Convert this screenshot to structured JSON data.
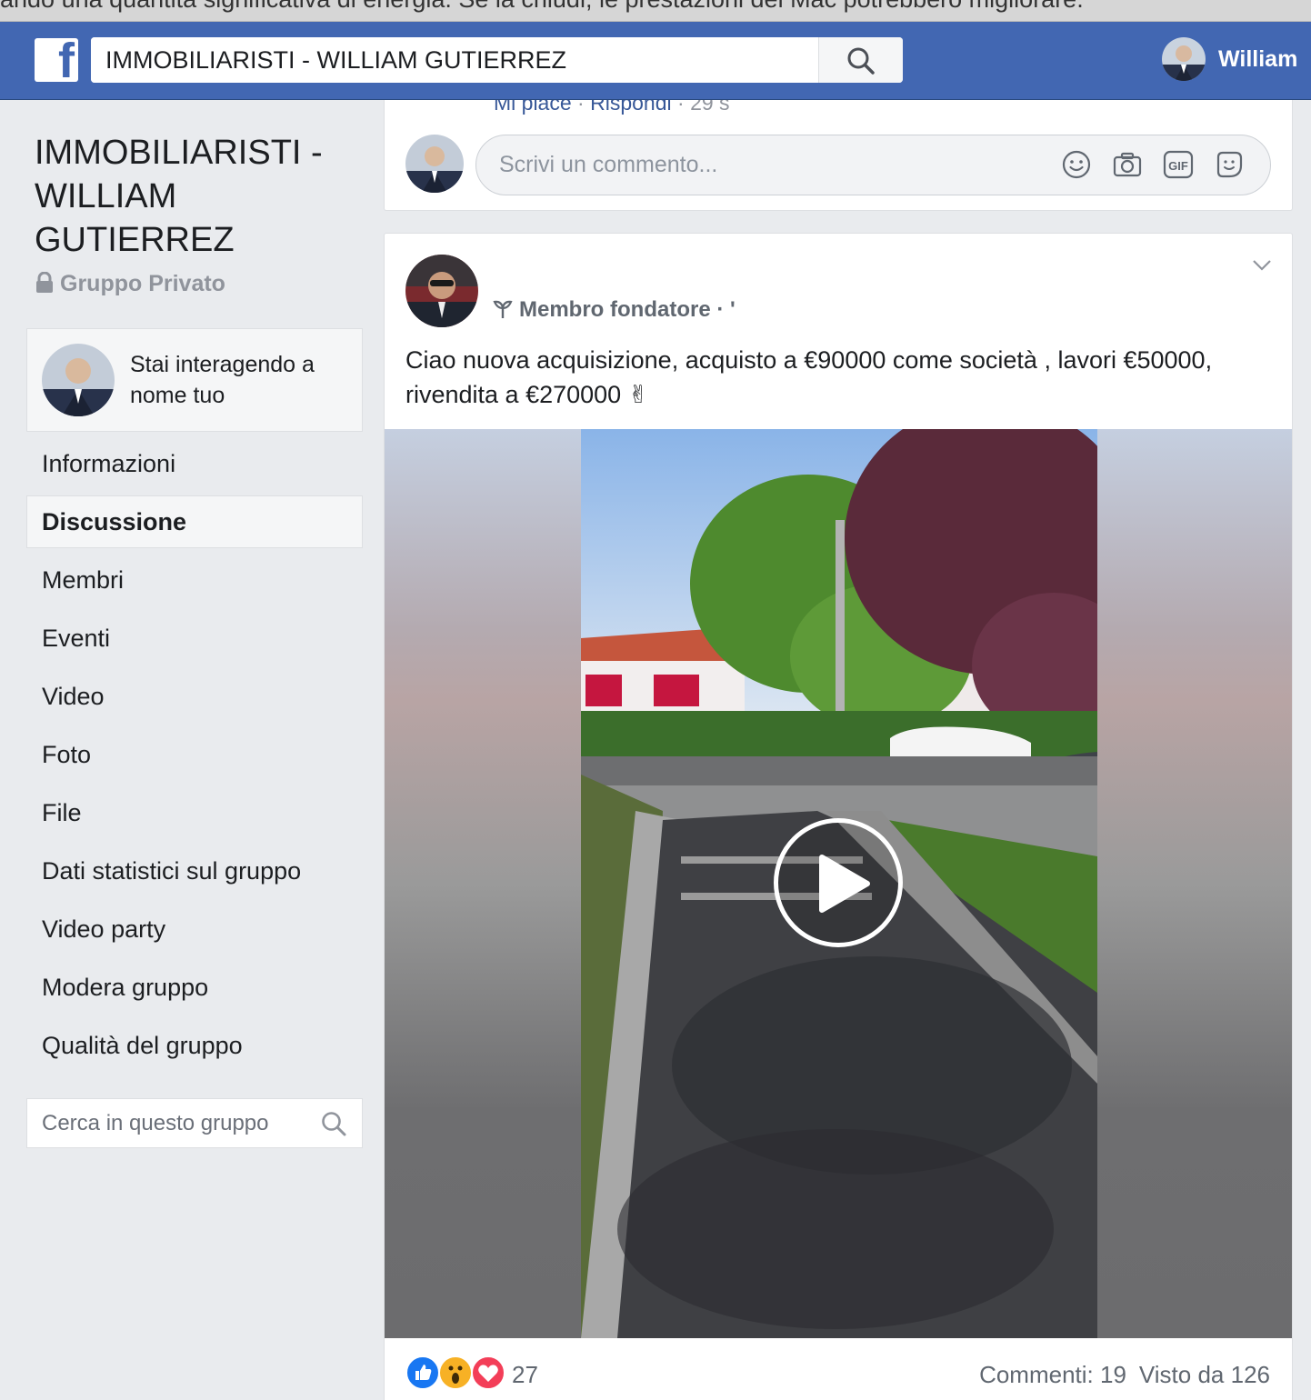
{
  "browser_notice": "ando una quantità significativa di energia. Se la chiudi, le prestazioni del Mac potrebbero migliorare.",
  "topbar": {
    "logo": "f",
    "search_value": "IMMOBILIARISTI - WILLIAM GUTIERREZ",
    "user_name": "William"
  },
  "sidebar": {
    "group_title": "IMMOBILIARISTI - WILLIAM GUTIERREZ",
    "privacy": "Gruppo Privato",
    "acting_as": "Stai interagendo a nome tuo",
    "nav": [
      {
        "label": "Informazioni"
      },
      {
        "label": "Discussione"
      },
      {
        "label": "Membri"
      },
      {
        "label": "Eventi"
      },
      {
        "label": "Video"
      },
      {
        "label": "Foto"
      },
      {
        "label": "File"
      },
      {
        "label": "Dati statistici sul gruppo"
      },
      {
        "label": "Video party"
      },
      {
        "label": "Modera gruppo"
      },
      {
        "label": "Qualità del gruppo"
      }
    ],
    "active_nav": "Discussione",
    "search_placeholder": "Cerca in questo gruppo"
  },
  "previous_comment": {
    "like": "Mi piace",
    "reply": "Rispondi",
    "time": "29 s"
  },
  "comment_box": {
    "placeholder": "Scrivi un commento...",
    "icons": [
      "emoji-icon",
      "camera-icon",
      "gif-icon",
      "sticker-icon"
    ]
  },
  "post": {
    "badge": "Membro fondatore",
    "text": "Ciao nuova acquisizione, acquisto a €90000 come società , lavori €50000, rivendita a €270000 ✌",
    "reactions_count": "27",
    "comments": "Commenti: 19",
    "views": "Visto da 126"
  },
  "colors": {
    "brand": "#4267b2",
    "link": "#385898",
    "like": "#1877f2",
    "love": "#f33e58",
    "wow": "#f7b125"
  }
}
